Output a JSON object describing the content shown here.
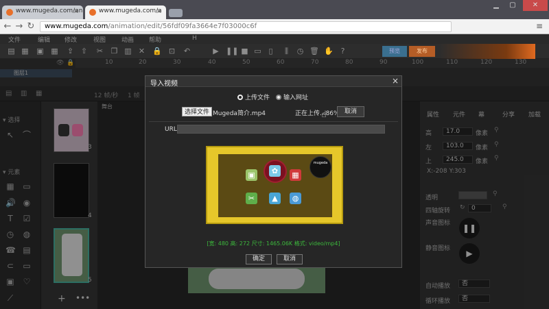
{
  "browser": {
    "tabs": [
      {
        "label": "www.mugeda.com/ani"
      },
      {
        "label": "www.mugeda.com/a"
      }
    ],
    "url_host": "www.mugeda.com",
    "url_path": "/animation/edit/56fdf09fa3664e7f03000c6f"
  },
  "menubar": [
    "文件",
    "编辑",
    "修改",
    "视图",
    "动画",
    "帮助",
    "H"
  ],
  "toolbar": {
    "preview_label": "预览",
    "publish_label": "发布"
  },
  "ruler_ticks": [
    "10",
    "20",
    "30",
    "40",
    "50",
    "60",
    "70",
    "80",
    "90",
    "100",
    "110",
    "120",
    "130"
  ],
  "timeline": {
    "layer_label": "图层1",
    "frames_label": "12 帧/秒",
    "frame_label": "1 帧"
  },
  "left_panel": {
    "section1": "▾ 选择",
    "section2": "▾ 元素"
  },
  "pages": {
    "numbers": [
      "3",
      "4",
      "5"
    ],
    "stage_tab": "舞台"
  },
  "right_panel": {
    "tabs": [
      "属性",
      "元件",
      "幕",
      "分享",
      "加载"
    ],
    "fields": [
      {
        "label": "高",
        "value": "17.0",
        "unit": "像素"
      },
      {
        "label": "左",
        "value": "103.0",
        "unit": "像素"
      },
      {
        "label": "上",
        "value": "245.0",
        "unit": "像素"
      }
    ],
    "coords": "X:-208  Y:303",
    "opacity_label": "透明",
    "rotation_label": "四轴旋转",
    "rotation_value": "0",
    "sound_icon_label": "声音图标",
    "mute_icon_label": "静音图标",
    "autoplay_label": "自动播放",
    "autoplay_value": "否",
    "loop_label": "循环播放",
    "loop_value": "否"
  },
  "dialog": {
    "title": "导入视频",
    "radio_upload": "上传文件",
    "radio_url": "输入网址",
    "choose_file": "选择文件",
    "file_name": "Mugeda简介.mp4",
    "upload_status": "正在上传...86%",
    "cancel_upload": "取消",
    "url_label": "URL",
    "url_value": "",
    "video_info": "[宽: 480  高: 272  尺寸: 1465.06K  格式: video/mp4]",
    "ok": "确定",
    "cancel": "取消",
    "preview_badge": "mugeda"
  },
  "colors": {
    "accent_preview": "#3a6f8f",
    "accent_publish": "#b55d26",
    "info_green": "#3cb83c"
  }
}
